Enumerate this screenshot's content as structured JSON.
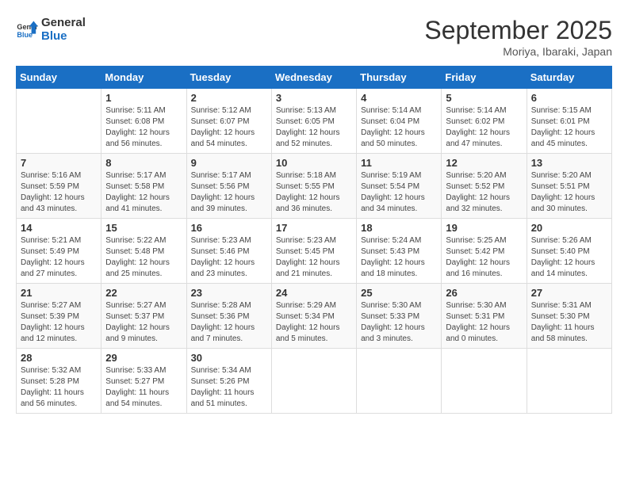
{
  "header": {
    "logo_line1": "General",
    "logo_line2": "Blue",
    "month": "September 2025",
    "location": "Moriya, Ibaraki, Japan"
  },
  "weekdays": [
    "Sunday",
    "Monday",
    "Tuesday",
    "Wednesday",
    "Thursday",
    "Friday",
    "Saturday"
  ],
  "weeks": [
    [
      {
        "day": "",
        "info": ""
      },
      {
        "day": "1",
        "info": "Sunrise: 5:11 AM\nSunset: 6:08 PM\nDaylight: 12 hours\nand 56 minutes."
      },
      {
        "day": "2",
        "info": "Sunrise: 5:12 AM\nSunset: 6:07 PM\nDaylight: 12 hours\nand 54 minutes."
      },
      {
        "day": "3",
        "info": "Sunrise: 5:13 AM\nSunset: 6:05 PM\nDaylight: 12 hours\nand 52 minutes."
      },
      {
        "day": "4",
        "info": "Sunrise: 5:14 AM\nSunset: 6:04 PM\nDaylight: 12 hours\nand 50 minutes."
      },
      {
        "day": "5",
        "info": "Sunrise: 5:14 AM\nSunset: 6:02 PM\nDaylight: 12 hours\nand 47 minutes."
      },
      {
        "day": "6",
        "info": "Sunrise: 5:15 AM\nSunset: 6:01 PM\nDaylight: 12 hours\nand 45 minutes."
      }
    ],
    [
      {
        "day": "7",
        "info": "Sunrise: 5:16 AM\nSunset: 5:59 PM\nDaylight: 12 hours\nand 43 minutes."
      },
      {
        "day": "8",
        "info": "Sunrise: 5:17 AM\nSunset: 5:58 PM\nDaylight: 12 hours\nand 41 minutes."
      },
      {
        "day": "9",
        "info": "Sunrise: 5:17 AM\nSunset: 5:56 PM\nDaylight: 12 hours\nand 39 minutes."
      },
      {
        "day": "10",
        "info": "Sunrise: 5:18 AM\nSunset: 5:55 PM\nDaylight: 12 hours\nand 36 minutes."
      },
      {
        "day": "11",
        "info": "Sunrise: 5:19 AM\nSunset: 5:54 PM\nDaylight: 12 hours\nand 34 minutes."
      },
      {
        "day": "12",
        "info": "Sunrise: 5:20 AM\nSunset: 5:52 PM\nDaylight: 12 hours\nand 32 minutes."
      },
      {
        "day": "13",
        "info": "Sunrise: 5:20 AM\nSunset: 5:51 PM\nDaylight: 12 hours\nand 30 minutes."
      }
    ],
    [
      {
        "day": "14",
        "info": "Sunrise: 5:21 AM\nSunset: 5:49 PM\nDaylight: 12 hours\nand 27 minutes."
      },
      {
        "day": "15",
        "info": "Sunrise: 5:22 AM\nSunset: 5:48 PM\nDaylight: 12 hours\nand 25 minutes."
      },
      {
        "day": "16",
        "info": "Sunrise: 5:23 AM\nSunset: 5:46 PM\nDaylight: 12 hours\nand 23 minutes."
      },
      {
        "day": "17",
        "info": "Sunrise: 5:23 AM\nSunset: 5:45 PM\nDaylight: 12 hours\nand 21 minutes."
      },
      {
        "day": "18",
        "info": "Sunrise: 5:24 AM\nSunset: 5:43 PM\nDaylight: 12 hours\nand 18 minutes."
      },
      {
        "day": "19",
        "info": "Sunrise: 5:25 AM\nSunset: 5:42 PM\nDaylight: 12 hours\nand 16 minutes."
      },
      {
        "day": "20",
        "info": "Sunrise: 5:26 AM\nSunset: 5:40 PM\nDaylight: 12 hours\nand 14 minutes."
      }
    ],
    [
      {
        "day": "21",
        "info": "Sunrise: 5:27 AM\nSunset: 5:39 PM\nDaylight: 12 hours\nand 12 minutes."
      },
      {
        "day": "22",
        "info": "Sunrise: 5:27 AM\nSunset: 5:37 PM\nDaylight: 12 hours\nand 9 minutes."
      },
      {
        "day": "23",
        "info": "Sunrise: 5:28 AM\nSunset: 5:36 PM\nDaylight: 12 hours\nand 7 minutes."
      },
      {
        "day": "24",
        "info": "Sunrise: 5:29 AM\nSunset: 5:34 PM\nDaylight: 12 hours\nand 5 minutes."
      },
      {
        "day": "25",
        "info": "Sunrise: 5:30 AM\nSunset: 5:33 PM\nDaylight: 12 hours\nand 3 minutes."
      },
      {
        "day": "26",
        "info": "Sunrise: 5:30 AM\nSunset: 5:31 PM\nDaylight: 12 hours\nand 0 minutes."
      },
      {
        "day": "27",
        "info": "Sunrise: 5:31 AM\nSunset: 5:30 PM\nDaylight: 11 hours\nand 58 minutes."
      }
    ],
    [
      {
        "day": "28",
        "info": "Sunrise: 5:32 AM\nSunset: 5:28 PM\nDaylight: 11 hours\nand 56 minutes."
      },
      {
        "day": "29",
        "info": "Sunrise: 5:33 AM\nSunset: 5:27 PM\nDaylight: 11 hours\nand 54 minutes."
      },
      {
        "day": "30",
        "info": "Sunrise: 5:34 AM\nSunset: 5:26 PM\nDaylight: 11 hours\nand 51 minutes."
      },
      {
        "day": "",
        "info": ""
      },
      {
        "day": "",
        "info": ""
      },
      {
        "day": "",
        "info": ""
      },
      {
        "day": "",
        "info": ""
      }
    ]
  ]
}
